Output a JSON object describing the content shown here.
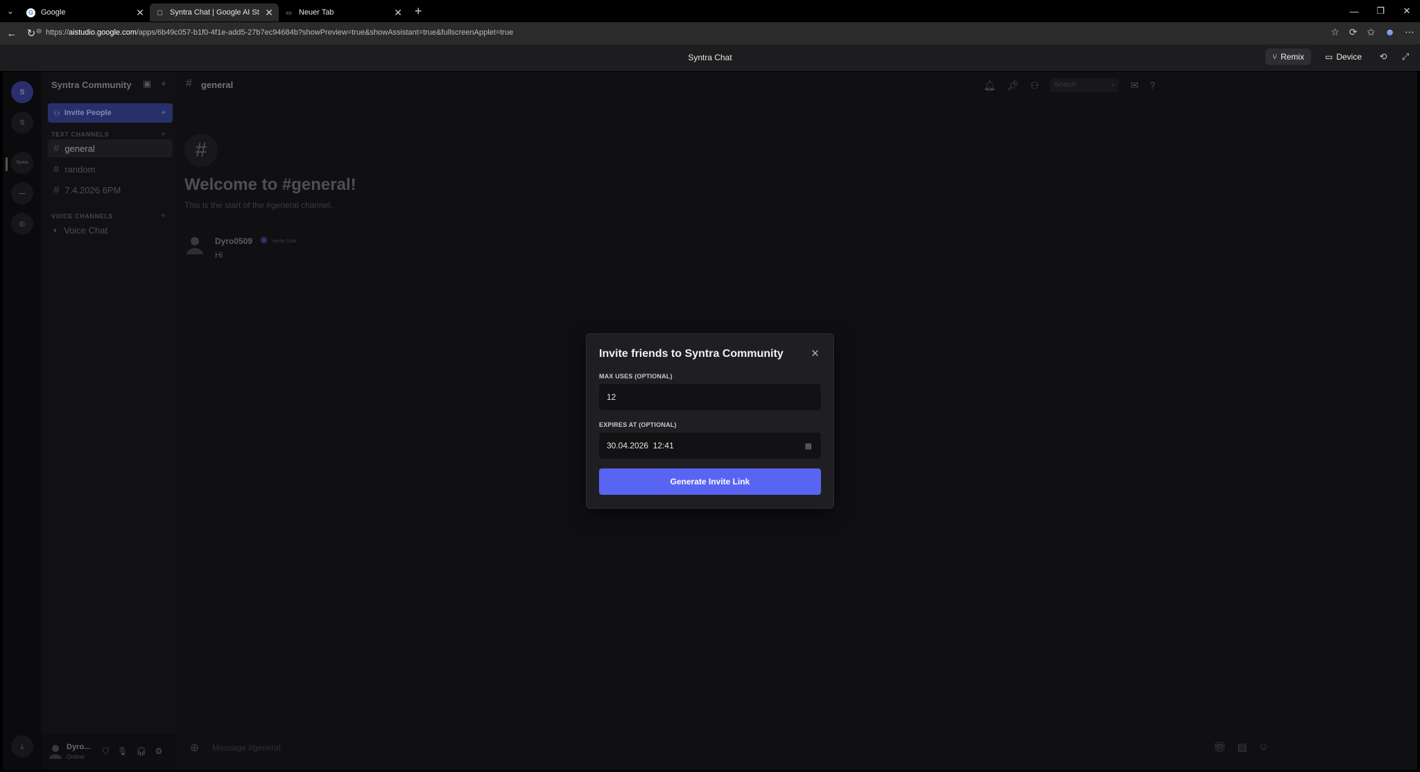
{
  "browser": {
    "tabs": [
      {
        "title": "Google",
        "favicon": "G"
      },
      {
        "title": "Syntra Chat | Google AI Studio",
        "favicon": "▢"
      },
      {
        "title": "Neuer Tab",
        "favicon": "▭"
      }
    ],
    "url_prefix": "https://",
    "url_host": "aistudio.google.com",
    "url_path": "/apps/6b49c057-b1f0-4f1e-add5-27b7ec94684b?showPreview=true&showAssistant=true&fullscreenApplet=true"
  },
  "studio": {
    "title": "Syntra Chat",
    "remix_label": "Remix",
    "device_label": "Device"
  },
  "servers": [
    {
      "label": "S"
    },
    {
      "label": "S"
    },
    {
      "label": "Syntra"
    },
    {
      "label": "—"
    },
    {
      "label": "◎"
    }
  ],
  "sidebar": {
    "server_name": "Syntra Community",
    "invite_label": "Invite People",
    "text_category": "TEXT CHANNELS",
    "text_channels": [
      "general",
      "random",
      "7.4.2026 6PM"
    ],
    "voice_category": "VOICE CHANNELS",
    "voice_channels": [
      "Voice Chat"
    ],
    "user": {
      "name": "Dyro...",
      "status": "Online"
    }
  },
  "channel": {
    "name": "general",
    "search_placeholder": "Search",
    "welcome_title": "Welcome to #general!",
    "welcome_sub": "This is the start of the #general channel.",
    "messages": [
      {
        "author": "Dyro0509",
        "time": "Heute Date",
        "text": "Hi"
      }
    ],
    "composer_placeholder": "Message #general"
  },
  "modal": {
    "title": "Invite friends to Syntra Community",
    "max_uses_label": "MAX USES (OPTIONAL)",
    "max_uses_value": "12",
    "expires_label": "EXPIRES AT (OPTIONAL)",
    "expires_value": "30.04.2026  12:41",
    "generate_label": "Generate Invite Link"
  },
  "colors": {
    "accent": "#5865f2",
    "background": "#101013",
    "modal_bg": "#1f1f23"
  }
}
